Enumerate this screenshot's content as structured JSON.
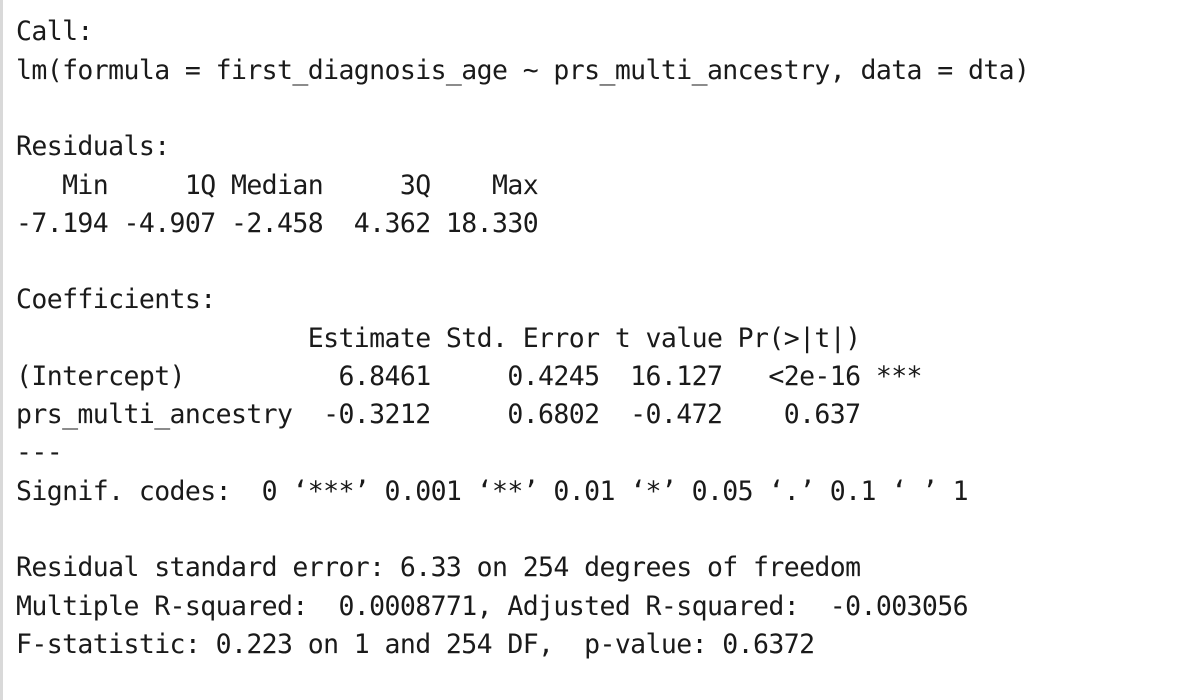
{
  "console": {
    "lines": [
      "Call:",
      "lm(formula = first_diagnosis_age ~ prs_multi_ancestry, data = dta)",
      "",
      "Residuals:",
      "   Min     1Q Median     3Q    Max ",
      "-7.194 -4.907 -2.458  4.362 18.330 ",
      "",
      "Coefficients:",
      "                   Estimate Std. Error t value Pr(>|t|)    ",
      "(Intercept)          6.8461     0.4245  16.127   <2e-16 ***",
      "prs_multi_ancestry  -0.3212     0.6802  -0.472    0.637    ",
      "---",
      "Signif. codes:  0 ‘***’ 0.001 ‘**’ 0.01 ‘*’ 0.05 ‘.’ 0.1 ‘ ’ 1",
      "",
      "Residual standard error: 6.33 on 254 degrees of freedom",
      "Multiple R-squared:  0.0008771,\tAdjusted R-squared:  -0.003056 ",
      "F-statistic: 0.223 on 1 and 254 DF,  p-value: 0.6372"
    ]
  },
  "colors": {
    "background": "#ffffff",
    "text": "#1a1a1a",
    "left_border": "#d9d9d9"
  }
}
